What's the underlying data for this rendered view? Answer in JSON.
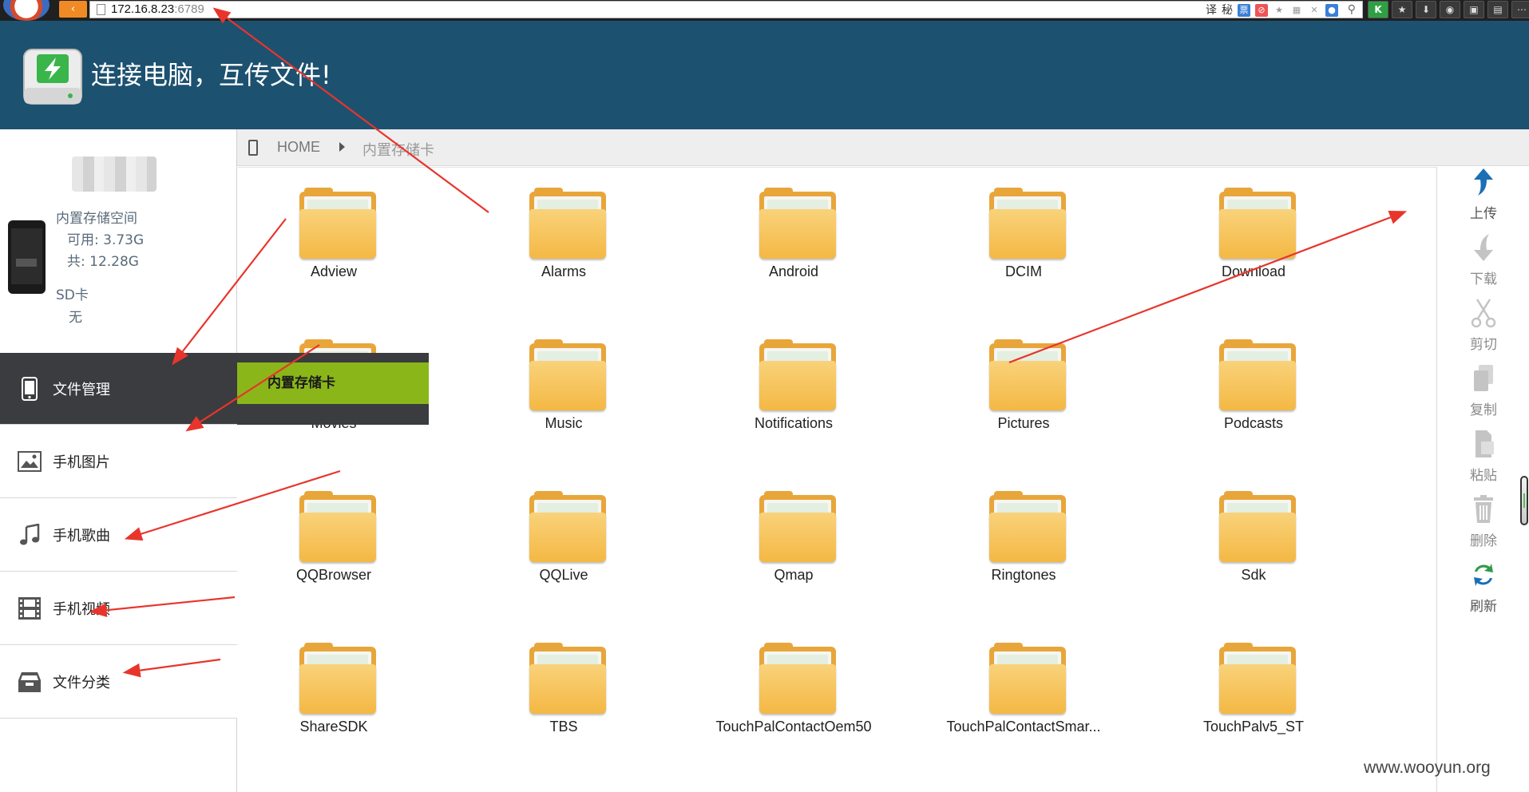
{
  "browser": {
    "url_host": "172.16.8.23",
    "url_port": ":6789",
    "addr_icon_labels": [
      "译",
      "秘",
      "票"
    ]
  },
  "app": {
    "title": "连接电脑，互传文件!",
    "accent_color": "#1d5170",
    "highlight_color": "#8ab619"
  },
  "device": {
    "internal_label": "内置存储空间",
    "available": "可用: 3.73G",
    "total": "共: 12.28G",
    "sd_label": "SD卡",
    "sd_value": "无"
  },
  "nav": {
    "items": [
      {
        "label": "文件管理",
        "icon": "phone-icon"
      },
      {
        "label": "手机图片",
        "icon": "image-icon"
      },
      {
        "label": "手机歌曲",
        "icon": "music-note-icon"
      },
      {
        "label": "手机视频",
        "icon": "film-icon"
      },
      {
        "label": "文件分类",
        "icon": "archive-box-icon"
      }
    ],
    "active": "文件管理"
  },
  "popup": {
    "item_label": "内置存储卡"
  },
  "breadcrumb": {
    "home": "HOME",
    "current": "内置存储卡"
  },
  "files": [
    {
      "name": "Adview"
    },
    {
      "name": "Alarms"
    },
    {
      "name": "Android"
    },
    {
      "name": "DCIM"
    },
    {
      "name": "Download"
    },
    {
      "name": "Movies"
    },
    {
      "name": "Music"
    },
    {
      "name": "Notifications"
    },
    {
      "name": "Pictures"
    },
    {
      "name": "Podcasts"
    },
    {
      "name": "QQBrowser"
    },
    {
      "name": "QQLive"
    },
    {
      "name": "Qmap"
    },
    {
      "name": "Ringtones"
    },
    {
      "name": "Sdk"
    },
    {
      "name": "ShareSDK"
    },
    {
      "name": "TBS"
    },
    {
      "name": "TouchPalContactOem50"
    },
    {
      "name": "TouchPalContactSmar..."
    },
    {
      "name": "TouchPalv5_ST"
    }
  ],
  "actions": {
    "upload": "上传",
    "download": "下载",
    "cut": "剪切",
    "copy": "复制",
    "paste": "粘贴",
    "delete": "删除",
    "refresh": "刷新"
  },
  "watermark": "www.wooyun.org"
}
